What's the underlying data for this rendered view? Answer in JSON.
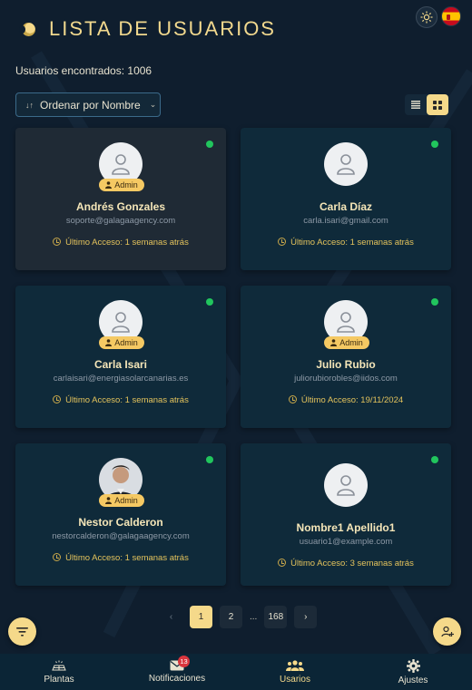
{
  "header": {
    "title": "LISTA DE USUARIOS"
  },
  "summary": {
    "count_text": "Usuarios encontrados: 1006"
  },
  "toolbar": {
    "sort_label": "Ordenar por Nombre",
    "sort_icon": "sort-az-icon",
    "view_mode": "grid"
  },
  "users": [
    {
      "name": "Andrés Gonzales",
      "email": "soporte@galagaagency.com",
      "role": "Admin",
      "last_access": "Último Acceso: 1 semanas atrás",
      "online": true,
      "avatar": "default",
      "selected": true
    },
    {
      "name": "Carla Díaz",
      "email": "carla.isari@gmail.com",
      "role": "",
      "last_access": "Último Acceso: 1 semanas atrás",
      "online": true,
      "avatar": "default",
      "selected": false
    },
    {
      "name": "Carla Isari",
      "email": "carlaisari@energiasolarcanarias.es",
      "role": "Admin",
      "last_access": "Último Acceso: 1 semanas atrás",
      "online": true,
      "avatar": "default",
      "selected": false
    },
    {
      "name": "Julio Rubio",
      "email": "juliorubiorobles@iidos.com",
      "role": "Admin",
      "last_access": "Último Acceso: 19/11/2024",
      "online": true,
      "avatar": "default",
      "selected": false
    },
    {
      "name": "Nestor Calderon",
      "email": "nestorcalderon@galagaagency.com",
      "role": "Admin",
      "last_access": "Último Acceso: 1 semanas atrás",
      "online": true,
      "avatar": "photo",
      "selected": false
    },
    {
      "name": "Nombre1 Apellido1",
      "email": "usuario1@example.com",
      "role": "",
      "last_access": "Último Acceso: 3 semanas atrás",
      "online": true,
      "avatar": "default",
      "selected": false
    }
  ],
  "pagination": {
    "prev": "‹",
    "pages": [
      "1",
      "2"
    ],
    "ellipsis": "...",
    "last": "168",
    "next": "›",
    "current": "1"
  },
  "bottom_nav": [
    {
      "label": "Plantas",
      "icon": "solar-panel-icon",
      "active": false
    },
    {
      "label": "Notificaciones",
      "icon": "mail-icon",
      "active": false,
      "badge": "13"
    },
    {
      "label": "Usarios",
      "icon": "users-icon",
      "active": true
    },
    {
      "label": "Ajustes",
      "icon": "gear-icon",
      "active": false
    }
  ],
  "colors": {
    "accent": "#f5d98a",
    "background": "#0f1e2e",
    "card": "#0f2a3a",
    "online": "#21c55d",
    "badge": "#d9363e"
  }
}
